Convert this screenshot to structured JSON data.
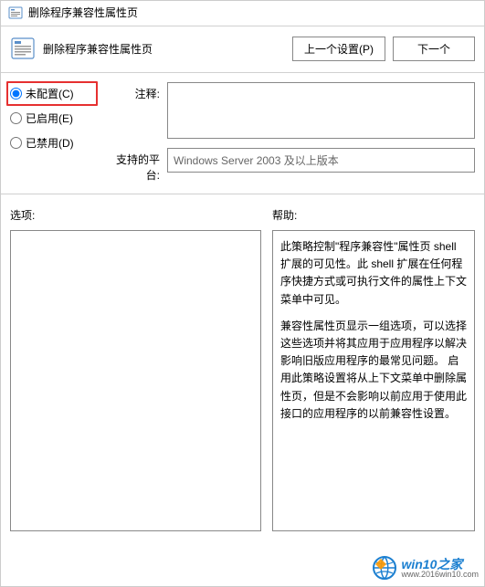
{
  "window": {
    "title": "删除程序兼容性属性页"
  },
  "header": {
    "title": "删除程序兼容性属性页",
    "nav": {
      "prev": "上一个设置(P)",
      "next": "下一个"
    }
  },
  "radios": {
    "not_configured": "未配置(C)",
    "enabled": "已启用(E)",
    "disabled": "已禁用(D)"
  },
  "fields": {
    "comment_label": "注释:",
    "platform_label": "支持的平台:",
    "platform_value": "Windows Server 2003 及以上版本"
  },
  "columns": {
    "options": "选项:",
    "help": "帮助:"
  },
  "help": {
    "p1": "此策略控制\"程序兼容性\"属性页 shell 扩展的可见性。此 shell 扩展在任何程序快捷方式或可执行文件的属性上下文菜单中可见。",
    "p2": "兼容性属性页显示一组选项，可以选择这些选项并将其应用于应用程序以解决影响旧版应用程序的最常见问题。 启用此策略设置将从上下文菜单中删除属性页，但是不会影响以前应用于使用此接口的应用程序的以前兼容性设置。"
  },
  "watermark": {
    "line1": "win10之家",
    "line2": "www.2016win10.com"
  }
}
